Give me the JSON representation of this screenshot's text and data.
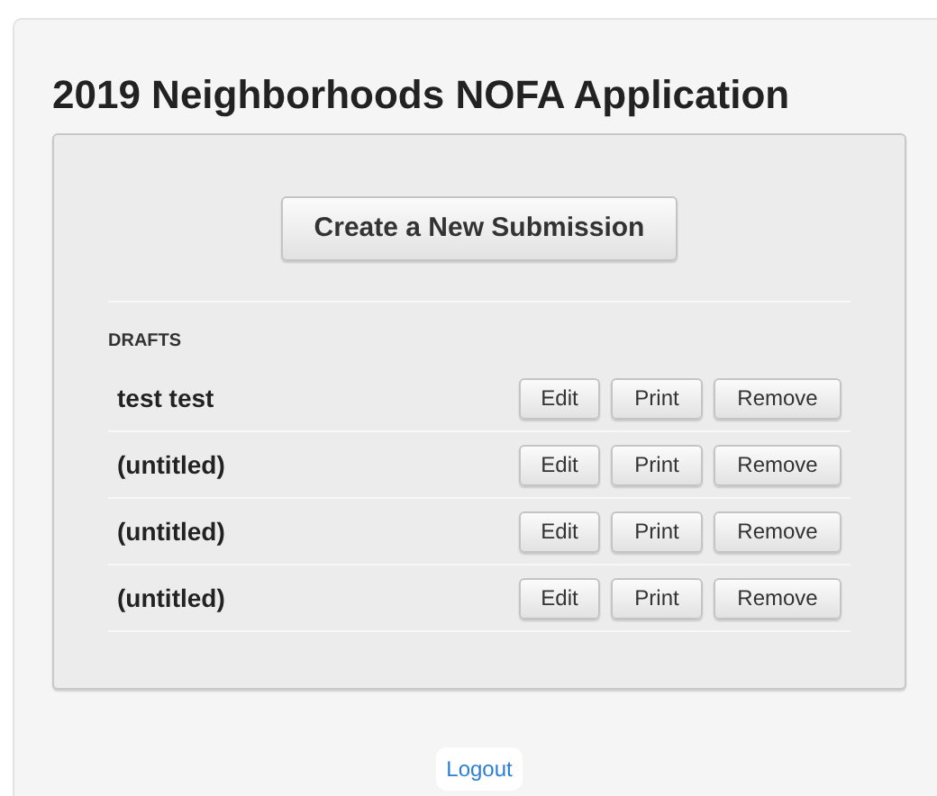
{
  "title": "2019 Neighborhoods NOFA Application",
  "create_button": "Create a New Submission",
  "drafts": {
    "heading": "DRAFTS",
    "rows": [
      {
        "name": "test test",
        "actions": [
          "Edit",
          "Print",
          "Remove"
        ]
      },
      {
        "name": "(untitled)",
        "actions": [
          "Edit",
          "Print",
          "Remove"
        ]
      },
      {
        "name": "(untitled)",
        "actions": [
          "Edit",
          "Print",
          "Remove"
        ]
      },
      {
        "name": "(untitled)",
        "actions": [
          "Edit",
          "Print",
          "Remove"
        ]
      }
    ]
  },
  "logout": "Logout"
}
